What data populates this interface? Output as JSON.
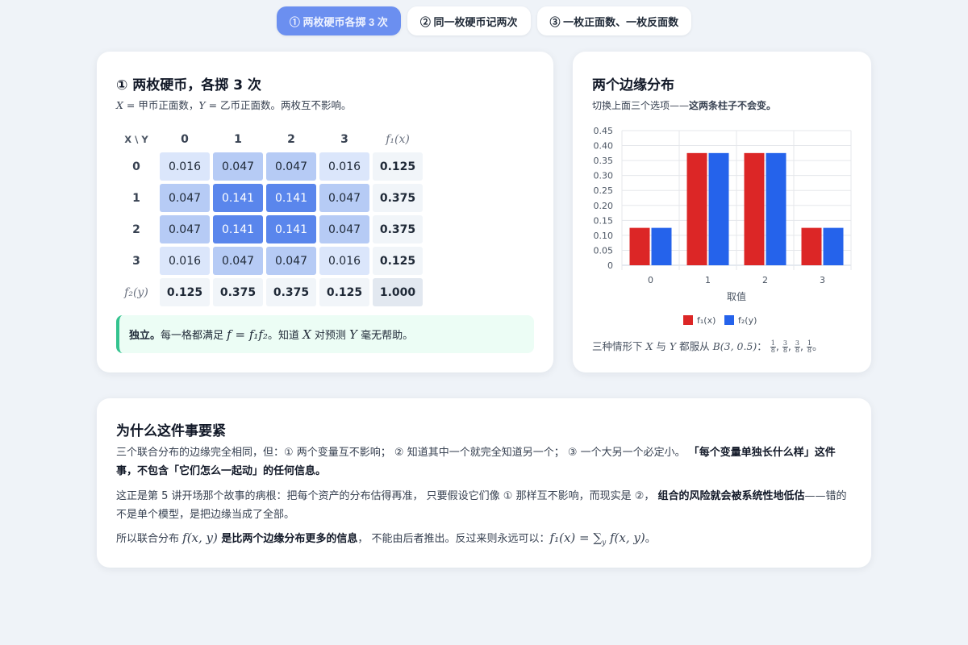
{
  "tabs": [
    {
      "label": "① 两枚硬币各掷 3 次",
      "active": true
    },
    {
      "label": "② 同一枚硬币记两次",
      "active": false
    },
    {
      "label": "③ 一枚正面数、一枚反面数",
      "active": false
    }
  ],
  "left": {
    "title": "① 两枚硬币，各掷 3 次",
    "subtitle": {
      "x": "X",
      "x_desc": " = 甲币正面数，",
      "y": "Y",
      "y_desc": " = 乙币正面数。两枚互不影响。"
    },
    "table": {
      "corner": "X \\ Y",
      "col_headers": [
        "0",
        "1",
        "2",
        "3"
      ],
      "marginal_col_header": "f₁(x)",
      "rows": [
        {
          "label": "0",
          "cells": [
            "0.016",
            "0.047",
            "0.047",
            "0.016"
          ],
          "marginal": "0.125"
        },
        {
          "label": "1",
          "cells": [
            "0.047",
            "0.141",
            "0.141",
            "0.047"
          ],
          "marginal": "0.375"
        },
        {
          "label": "2",
          "cells": [
            "0.047",
            "0.141",
            "0.141",
            "0.047"
          ],
          "marginal": "0.375"
        },
        {
          "label": "3",
          "cells": [
            "0.016",
            "0.047",
            "0.047",
            "0.016"
          ],
          "marginal": "0.125"
        }
      ],
      "marginal_row_label": "f₂(y)",
      "marginal_row": [
        "0.125",
        "0.375",
        "0.375",
        "0.125"
      ],
      "total": "1.000"
    },
    "callout": {
      "bold": "独立。",
      "text1": "每一格都满足 ",
      "formula": "f = f₁f₂",
      "text2": "。知道 ",
      "x": "X",
      "text3": " 对预测 ",
      "y": "Y",
      "text4": " 毫无帮助。"
    }
  },
  "right": {
    "title": "两个边缘分布",
    "subtitle_pre": "切换上面三个选项——",
    "subtitle_bold": "这两条柱子不会变。",
    "foot": {
      "pre": "三种情形下 ",
      "x": "X",
      "mid": " 与 ",
      "y": "Y",
      "mid2": " 都服从 ",
      "dist": "B(3, 0.5)",
      "colon": "：",
      "fracs": [
        [
          "1",
          "8"
        ],
        [
          "3",
          "8"
        ],
        [
          "3",
          "8"
        ],
        [
          "1",
          "8"
        ]
      ],
      "end": "。"
    }
  },
  "chart_data": {
    "type": "bar",
    "categories": [
      "0",
      "1",
      "2",
      "3"
    ],
    "series": [
      {
        "name": "f₁(x)",
        "values": [
          0.125,
          0.375,
          0.375,
          0.125
        ],
        "color": "#dc2626"
      },
      {
        "name": "f₂(y)",
        "values": [
          0.125,
          0.375,
          0.375,
          0.125
        ],
        "color": "#2563eb"
      }
    ],
    "xlabel": "取值",
    "ylabel": "",
    "ylim": [
      0,
      0.45
    ],
    "yticks": [
      "0",
      "0.05",
      "0.10",
      "0.15",
      "0.20",
      "0.25",
      "0.30",
      "0.35",
      "0.40",
      "0.45"
    ],
    "grid": true,
    "legend": "bottom"
  },
  "bottom": {
    "title": "为什么这件事要紧",
    "p1_text": "三个联合分布的边缘完全相同，但：① 两个变量互不影响； ② 知道其中一个就完全知道另一个； ③ 一个大另一个必定小。",
    "p1_bold": "「每个变量单独长什么样」这件事，不包含「它们怎么一起动」的任何信息。",
    "p2_text": "这正是第 5 讲开场那个故事的病根：把每个资产的分布估得再准， 只要假设它们像 ① 那样互不影响，而现实是 ②，",
    "p2_bold": "组合的风险就会被系统性地低估",
    "p2_end": "——错的不是单个模型，是把边缘当成了全部。",
    "p3_pre": "所以联合分布 ",
    "p3_fxy": "f(x, y)",
    "p3_bold": " 是比两个边缘分布更多的信息",
    "p3_mid": "， 不能由后者推出。反过来则永远可以：",
    "p3_formula": "f₁(x) = ∑",
    "p3_sub": "y",
    "p3_formula2": " f(x, y)",
    "p3_end": "。"
  }
}
